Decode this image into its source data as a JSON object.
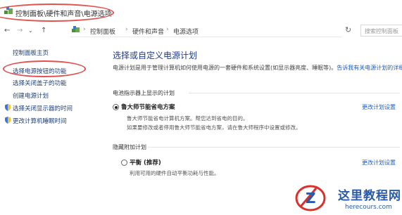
{
  "window": {
    "title": "控制面板\\硬件和声音\\电源选项"
  },
  "nav": {
    "back": "←",
    "forward": "→",
    "history": "⌄",
    "up": "↑",
    "breadcrumb": [
      "控制面板",
      "硬件和声音",
      "电源选项"
    ],
    "refresh": "↻",
    "search_placeholder": "搜索控制面板"
  },
  "sidebar": {
    "home": "控制面板主页",
    "items": [
      "选择电源按钮的功能",
      "选择关闭盖子的功能",
      "创建电源计划",
      "选择关闭显示器的时间",
      "更改计算机睡眠时间"
    ]
  },
  "main": {
    "heading": "选择或自定义电源计划",
    "description": "电源计划是用于管理计算机如何使用电源的一套硬件和系统设置(如显示器亮度、睡眠等)。",
    "description_link": "告诉我有关电源计划的详细信息",
    "battery_group_label": "电池指示器上显示的计划",
    "hidden_group_label": "隐藏附加计划",
    "plans": [
      {
        "name": "鲁大师节能省电方案",
        "desc1": "鲁大师节能省电计算机方案。帮您达到省电的目的。",
        "desc2": "如果要修改或者停用鲁大师节能省电方案，请在鲁大师程序中设置或修改。",
        "change": "更改计划设置",
        "checked": true
      },
      {
        "name": "平衡 (推荐)",
        "desc1": "利用可用的硬件自动平衡功耗与性能。",
        "change": "更改计划设置",
        "checked": false
      }
    ]
  },
  "watermark": {
    "title": "这里教程网",
    "url": "herecours.com"
  },
  "colors": {
    "highlight": "#e0524f",
    "link": "#1a5cc8",
    "heading": "#1e3a8a"
  }
}
